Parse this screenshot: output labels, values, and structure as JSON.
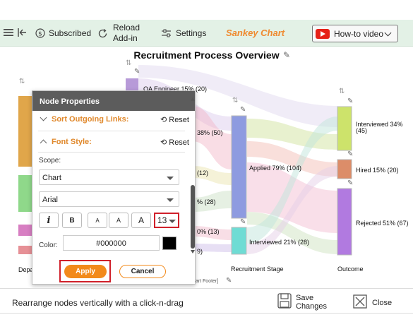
{
  "toolbar": {
    "subscribed_label": "Subscribed",
    "reload_label_line1": "Reload",
    "reload_label_line2": "Add-in",
    "settings_label": "Settings",
    "brand": "Sankey Chart",
    "howto_label": "How-to video"
  },
  "chart": {
    "title": "Recruitment Process Overview",
    "footer": "[Chart Footer]",
    "nodes": [
      {
        "id": "qa",
        "label": "QA Engineer 15% (20)"
      },
      {
        "id": "n38",
        "label": "38% (50)"
      },
      {
        "id": "n12",
        "label": "(12)"
      },
      {
        "id": "n28",
        "label": "% (28)"
      },
      {
        "id": "n13",
        "label": "0% (13)"
      },
      {
        "id": "n9",
        "label": "9)"
      },
      {
        "id": "applied",
        "label": "Applied 79% (104)"
      },
      {
        "id": "interviewed21",
        "label": "Interviewed 21% (28)"
      },
      {
        "id": "interviewed34_1",
        "label": "Interviewed 34%"
      },
      {
        "id": "interviewed34_2",
        "label": "(45)"
      },
      {
        "id": "hired",
        "label": "Hired 15% (20)"
      },
      {
        "id": "rejected",
        "label": "Rejected 51% (67)"
      }
    ],
    "axis_labels": {
      "col1": "Depa",
      "col3": "Recruitment Stage",
      "col4": "Outcome"
    }
  },
  "panel": {
    "title": "Node Properties",
    "sort_outgoing": "Sort Outgoing Links:",
    "font_style": "Font Style:",
    "reset": "Reset",
    "scope_label": "Scope:",
    "scope_value": "Chart",
    "font_value": "Arial",
    "italic": "i",
    "bold": "B",
    "size_small": "A",
    "size_medium": "A",
    "size_large": "A",
    "font_size": "13",
    "color_label": "Color:",
    "color_value": "#000000",
    "apply": "Apply",
    "cancel": "Cancel"
  },
  "status": {
    "hint": "Rearrange nodes vertically with a click-n-drag",
    "save_line1": "Save",
    "save_line2": "Changes",
    "close": "Close"
  }
}
